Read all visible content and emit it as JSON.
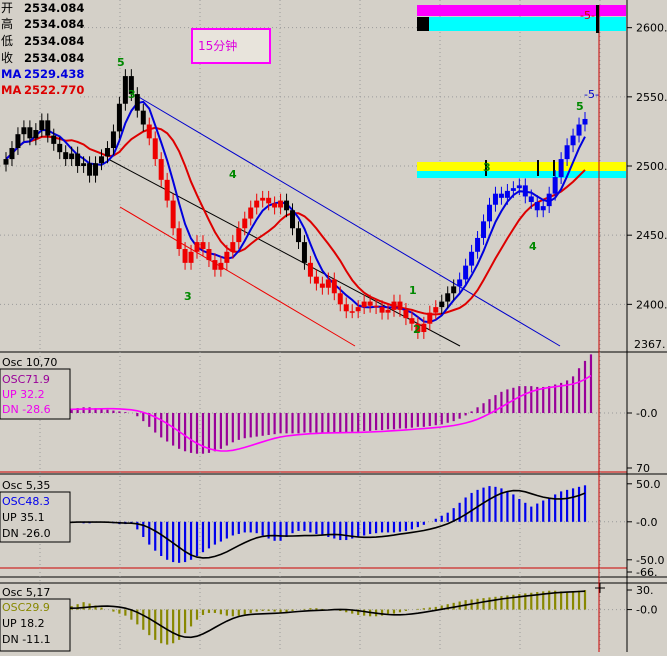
{
  "price_panel": {
    "ohlc": [
      {
        "label": "开",
        "value": "2534.084"
      },
      {
        "label": "高",
        "value": "2534.084"
      },
      {
        "label": "低",
        "value": "2534.084"
      },
      {
        "label": "收",
        "value": "2534.084"
      }
    ],
    "ma_fast": {
      "label": "MA",
      "value": "2529.438",
      "color": "#0000dd"
    },
    "ma_slow": {
      "label": "MA",
      "value": "2522.770",
      "color": "#dd0000"
    },
    "timeframe_label": "15分钟",
    "y_ticks": [
      "2600.",
      "2550.",
      "2500.",
      "2450.",
      "2400.",
      "2367."
    ],
    "waves": [
      "5",
      "3",
      "4",
      "3",
      "1",
      "2",
      "3",
      "4",
      "5",
      "-5-",
      "-5-"
    ]
  },
  "osc1": {
    "title": "Osc 10,70",
    "osc": "OSC71.9",
    "up": "UP  32.2",
    "dn": "DN  -28.6",
    "y_ticks": [
      "-0.0",
      "70"
    ]
  },
  "osc2": {
    "title": "Osc 5,35",
    "osc": "OSC48.3",
    "up": "UP  35.1",
    "dn": "DN  -26.0",
    "y_ticks": [
      "50.0",
      "-0.0",
      "-50.0",
      "-66."
    ]
  },
  "osc3": {
    "title": "Osc 5,17",
    "osc": "OSC29.9",
    "up": "UP  18.2",
    "dn": "DN  -11.1",
    "y_ticks": [
      "30.",
      "-0.0"
    ]
  },
  "chart_data": {
    "type": "candlestick",
    "price": {
      "ylim": [
        2367,
        2620
      ],
      "close": [
        2505,
        2513,
        2523,
        2528,
        2520,
        2526,
        2533,
        2522,
        2516,
        2510,
        2505,
        2509,
        2500,
        2502,
        2493,
        2502,
        2507,
        2513,
        2525,
        2545,
        2565,
        2552,
        2540,
        2530,
        2520,
        2505,
        2490,
        2475,
        2455,
        2440,
        2430,
        2438,
        2445,
        2440,
        2432,
        2425,
        2430,
        2438,
        2445,
        2455,
        2462,
        2470,
        2475,
        2477,
        2473,
        2470,
        2475,
        2468,
        2455,
        2445,
        2430,
        2420,
        2415,
        2412,
        2418,
        2408,
        2400,
        2395,
        2395,
        2398,
        2402,
        2399,
        2398,
        2394,
        2396,
        2402,
        2396,
        2390,
        2386,
        2380,
        2386,
        2394,
        2398,
        2402,
        2408,
        2413,
        2418,
        2428,
        2438,
        2448,
        2460,
        2472,
        2480,
        2477,
        2482,
        2484,
        2486,
        2478,
        2474,
        2468,
        2471,
        2480,
        2492,
        2505,
        2515,
        2522,
        2530,
        2534
      ],
      "color": [
        "k",
        "k",
        "k",
        "k",
        "k",
        "k",
        "k",
        "k",
        "k",
        "k",
        "k",
        "k",
        "k",
        "k",
        "k",
        "k",
        "k",
        "k",
        "k",
        "k",
        "k",
        "k",
        "k",
        "k",
        "r",
        "r",
        "r",
        "r",
        "r",
        "r",
        "r",
        "r",
        "r",
        "r",
        "r",
        "r",
        "r",
        "r",
        "r",
        "r",
        "r",
        "r",
        "r",
        "r",
        "r",
        "r",
        "r",
        "k",
        "k",
        "k",
        "k",
        "r",
        "r",
        "r",
        "r",
        "r",
        "r",
        "r",
        "r",
        "r",
        "r",
        "r",
        "r",
        "r",
        "r",
        "r",
        "r",
        "r",
        "r",
        "r",
        "r",
        "r",
        "r",
        "k",
        "k",
        "k",
        "b",
        "b",
        "b",
        "b",
        "b",
        "b",
        "b",
        "b",
        "b",
        "b",
        "b",
        "b",
        "b",
        "b",
        "b",
        "b",
        "b",
        "b",
        "b",
        "b",
        "b",
        "b"
      ]
    },
    "osc1": {
      "ylim": [
        -70,
        70
      ],
      "values": [
        0,
        2,
        4,
        5,
        6,
        6,
        5,
        4,
        3,
        3,
        4,
        5,
        6,
        7,
        7,
        6,
        5,
        4,
        3,
        2,
        1,
        0,
        -4,
        -10,
        -17,
        -24,
        -30,
        -35,
        -40,
        -44,
        -47,
        -49,
        -50,
        -50,
        -49,
        -47,
        -44,
        -40,
        -36,
        -33,
        -31,
        -30,
        -29,
        -28,
        -27,
        -26,
        -25,
        -25,
        -25,
        -25,
        -24,
        -24,
        -24,
        -24,
        -24,
        -24,
        -24,
        -24,
        -23,
        -23,
        -22,
        -22,
        -21,
        -21,
        -20,
        -20,
        -19,
        -19,
        -18,
        -17,
        -17,
        -16,
        -15,
        -14,
        -12,
        -10,
        -7,
        -3,
        2,
        7,
        12,
        17,
        22,
        26,
        29,
        31,
        33,
        33,
        33,
        32,
        32,
        33,
        35,
        37,
        40,
        45,
        55,
        64,
        72
      ],
      "up": 32.2,
      "dn": -28.6
    },
    "osc2": {
      "ylim": [
        -70,
        55
      ],
      "values": [
        0,
        -1,
        -2,
        -3,
        -3,
        -2,
        -1,
        0,
        1,
        1,
        1,
        0,
        -1,
        -2,
        -2,
        -1,
        0,
        -1,
        -2,
        -3,
        -3,
        -2,
        -10,
        -20,
        -30,
        -38,
        -45,
        -50,
        -53,
        -54,
        -53,
        -50,
        -45,
        -40,
        -35,
        -30,
        -26,
        -22,
        -18,
        -16,
        -14,
        -14,
        -15,
        -18,
        -22,
        -25,
        -25,
        -20,
        -15,
        -12,
        -12,
        -14,
        -16,
        -18,
        -20,
        -22,
        -24,
        -24,
        -22,
        -20,
        -18,
        -16,
        -15,
        -14,
        -14,
        -14,
        -13,
        -12,
        -10,
        -7,
        -4,
        0,
        4,
        8,
        12,
        18,
        25,
        32,
        38,
        42,
        45,
        47,
        46,
        44,
        40,
        36,
        30,
        25,
        20,
        24,
        28,
        32,
        36,
        40,
        42,
        44,
        46,
        48
      ],
      "up": 35.1,
      "dn": -26.0
    },
    "osc3": {
      "ylim": [
        -60,
        35
      ],
      "values": [
        0,
        3,
        5,
        6,
        4,
        2,
        0,
        -2,
        -1,
        1,
        3,
        5,
        8,
        11,
        9,
        6,
        3,
        0,
        -3,
        -6,
        -9,
        -15,
        -22,
        -30,
        -38,
        -45,
        -50,
        -52,
        -50,
        -45,
        -35,
        -25,
        -15,
        -8,
        -5,
        -5,
        -7,
        -9,
        -10,
        -9,
        -7,
        -5,
        -3,
        -2,
        -2,
        -3,
        -5,
        -4,
        -2,
        0,
        1,
        2,
        2,
        1,
        0,
        0,
        -2,
        -4,
        -6,
        -8,
        -9,
        -10,
        -10,
        -9,
        -8,
        -6,
        -4,
        -2,
        0,
        1,
        2,
        3,
        4,
        6,
        8,
        10,
        12,
        14,
        15,
        16,
        17,
        18,
        19,
        20,
        21,
        22,
        23,
        24,
        25,
        26,
        27,
        28,
        28,
        27,
        26,
        27,
        28,
        29
      ],
      "up": 18.2,
      "dn": -11.1
    }
  }
}
